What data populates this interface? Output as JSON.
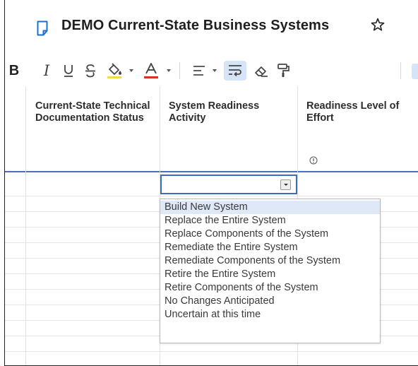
{
  "title_bar": {
    "doc_title": "DEMO Current-State Business Systems",
    "icons": {
      "document": "document-icon",
      "favorite": "star-icon"
    }
  },
  "toolbar": {
    "bold": "B",
    "italic": "I",
    "icons": [
      "underline-icon",
      "strikethrough-icon",
      "fill-color-icon",
      "text-color-icon",
      "align-icon",
      "wrap-text-icon",
      "clear-format-icon",
      "format-painter-icon"
    ],
    "colors": {
      "fill_underline": "#f2d94a",
      "text_underline": "#d93025",
      "active_bg": "#d6e4f7"
    }
  },
  "grid": {
    "columns": [
      {
        "label": "Current-State Technical Documentation Status"
      },
      {
        "label": "System Readiness Activity"
      },
      {
        "label": "Readiness Level of Effort",
        "info_icon": "info-icon"
      }
    ],
    "active_cell": {
      "value": ""
    },
    "colors": {
      "header_border": "#4a6ebd",
      "active_border": "#3d6bc2"
    }
  },
  "dropdown": {
    "options": [
      "Build New System",
      "Replace the Entire System",
      "Replace Components of the System",
      "Remediate the Entire System",
      "Remediate Components of the System",
      "Retire the Entire System",
      "Retire Components of the System",
      "No Changes Anticipated",
      "Uncertain at this time"
    ],
    "highlighted": "Build New System",
    "colors": {
      "highlight": "#dfe8f7"
    }
  }
}
